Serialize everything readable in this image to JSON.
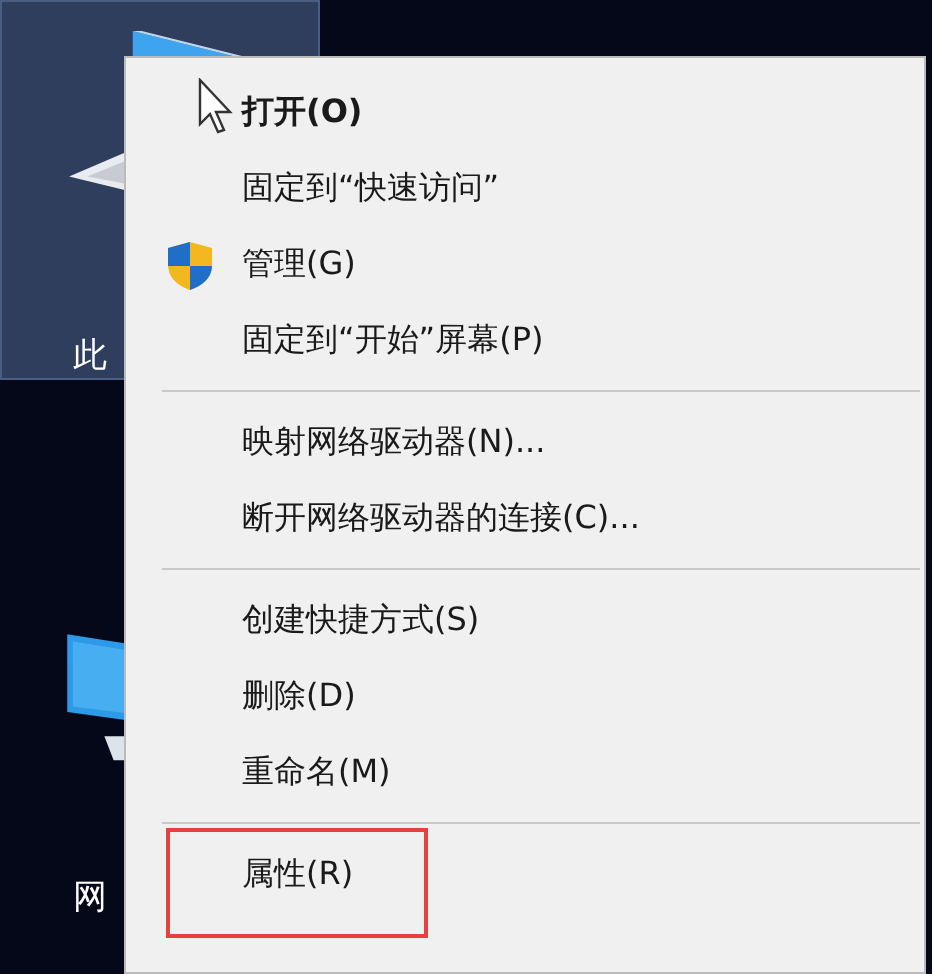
{
  "desktop_icons": [
    {
      "kind": "computer",
      "label": "此",
      "selected": true
    },
    {
      "kind": "network",
      "label": "网",
      "selected": false
    }
  ],
  "context_menu": {
    "items": [
      {
        "kind": "item",
        "label": "打开(O)",
        "bold": true,
        "highlighted": false
      },
      {
        "kind": "item",
        "label": "固定到“快速访问”",
        "bold": false,
        "highlighted": false
      },
      {
        "kind": "shield_item",
        "label": "管理(G)",
        "bold": false,
        "highlighted": false
      },
      {
        "kind": "item",
        "label": "固定到“开始”屏幕(P)",
        "bold": false,
        "highlighted": false
      },
      {
        "kind": "separator"
      },
      {
        "kind": "item",
        "label": "映射网络驱动器(N)...",
        "bold": false,
        "highlighted": false
      },
      {
        "kind": "item",
        "label": "断开网络驱动器的连接(C)...",
        "bold": false,
        "highlighted": false
      },
      {
        "kind": "separator"
      },
      {
        "kind": "item",
        "label": "创建快捷方式(S)",
        "bold": false,
        "highlighted": false
      },
      {
        "kind": "item",
        "label": "删除(D)",
        "bold": false,
        "highlighted": false
      },
      {
        "kind": "item",
        "label": "重命名(M)",
        "bold": false,
        "highlighted": false
      },
      {
        "kind": "separator"
      },
      {
        "kind": "item",
        "label": "属性(R)",
        "bold": false,
        "highlighted": true
      }
    ]
  }
}
